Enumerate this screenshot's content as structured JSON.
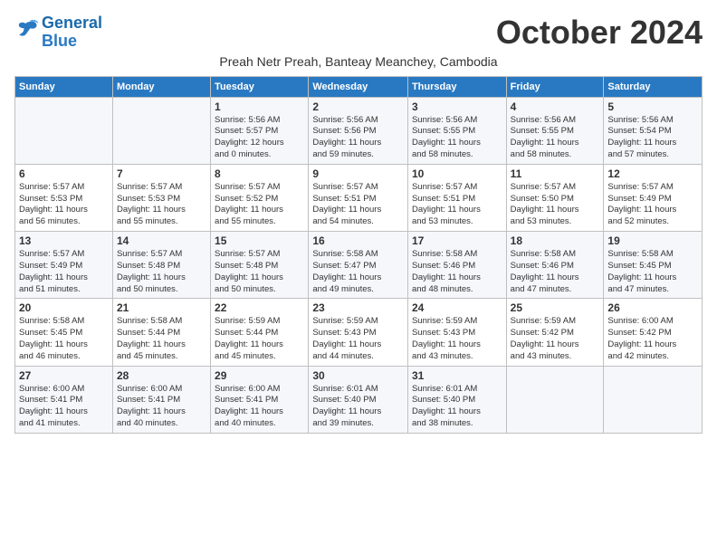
{
  "logo": {
    "line1": "General",
    "line2": "Blue"
  },
  "title": "October 2024",
  "subtitle": "Preah Netr Preah, Banteay Meanchey, Cambodia",
  "days_of_week": [
    "Sunday",
    "Monday",
    "Tuesday",
    "Wednesday",
    "Thursday",
    "Friday",
    "Saturday"
  ],
  "weeks": [
    [
      {
        "day": "",
        "info": ""
      },
      {
        "day": "",
        "info": ""
      },
      {
        "day": "1",
        "info": "Sunrise: 5:56 AM\nSunset: 5:57 PM\nDaylight: 12 hours\nand 0 minutes."
      },
      {
        "day": "2",
        "info": "Sunrise: 5:56 AM\nSunset: 5:56 PM\nDaylight: 11 hours\nand 59 minutes."
      },
      {
        "day": "3",
        "info": "Sunrise: 5:56 AM\nSunset: 5:55 PM\nDaylight: 11 hours\nand 58 minutes."
      },
      {
        "day": "4",
        "info": "Sunrise: 5:56 AM\nSunset: 5:55 PM\nDaylight: 11 hours\nand 58 minutes."
      },
      {
        "day": "5",
        "info": "Sunrise: 5:56 AM\nSunset: 5:54 PM\nDaylight: 11 hours\nand 57 minutes."
      }
    ],
    [
      {
        "day": "6",
        "info": "Sunrise: 5:57 AM\nSunset: 5:53 PM\nDaylight: 11 hours\nand 56 minutes."
      },
      {
        "day": "7",
        "info": "Sunrise: 5:57 AM\nSunset: 5:53 PM\nDaylight: 11 hours\nand 55 minutes."
      },
      {
        "day": "8",
        "info": "Sunrise: 5:57 AM\nSunset: 5:52 PM\nDaylight: 11 hours\nand 55 minutes."
      },
      {
        "day": "9",
        "info": "Sunrise: 5:57 AM\nSunset: 5:51 PM\nDaylight: 11 hours\nand 54 minutes."
      },
      {
        "day": "10",
        "info": "Sunrise: 5:57 AM\nSunset: 5:51 PM\nDaylight: 11 hours\nand 53 minutes."
      },
      {
        "day": "11",
        "info": "Sunrise: 5:57 AM\nSunset: 5:50 PM\nDaylight: 11 hours\nand 53 minutes."
      },
      {
        "day": "12",
        "info": "Sunrise: 5:57 AM\nSunset: 5:49 PM\nDaylight: 11 hours\nand 52 minutes."
      }
    ],
    [
      {
        "day": "13",
        "info": "Sunrise: 5:57 AM\nSunset: 5:49 PM\nDaylight: 11 hours\nand 51 minutes."
      },
      {
        "day": "14",
        "info": "Sunrise: 5:57 AM\nSunset: 5:48 PM\nDaylight: 11 hours\nand 50 minutes."
      },
      {
        "day": "15",
        "info": "Sunrise: 5:57 AM\nSunset: 5:48 PM\nDaylight: 11 hours\nand 50 minutes."
      },
      {
        "day": "16",
        "info": "Sunrise: 5:58 AM\nSunset: 5:47 PM\nDaylight: 11 hours\nand 49 minutes."
      },
      {
        "day": "17",
        "info": "Sunrise: 5:58 AM\nSunset: 5:46 PM\nDaylight: 11 hours\nand 48 minutes."
      },
      {
        "day": "18",
        "info": "Sunrise: 5:58 AM\nSunset: 5:46 PM\nDaylight: 11 hours\nand 47 minutes."
      },
      {
        "day": "19",
        "info": "Sunrise: 5:58 AM\nSunset: 5:45 PM\nDaylight: 11 hours\nand 47 minutes."
      }
    ],
    [
      {
        "day": "20",
        "info": "Sunrise: 5:58 AM\nSunset: 5:45 PM\nDaylight: 11 hours\nand 46 minutes."
      },
      {
        "day": "21",
        "info": "Sunrise: 5:58 AM\nSunset: 5:44 PM\nDaylight: 11 hours\nand 45 minutes."
      },
      {
        "day": "22",
        "info": "Sunrise: 5:59 AM\nSunset: 5:44 PM\nDaylight: 11 hours\nand 45 minutes."
      },
      {
        "day": "23",
        "info": "Sunrise: 5:59 AM\nSunset: 5:43 PM\nDaylight: 11 hours\nand 44 minutes."
      },
      {
        "day": "24",
        "info": "Sunrise: 5:59 AM\nSunset: 5:43 PM\nDaylight: 11 hours\nand 43 minutes."
      },
      {
        "day": "25",
        "info": "Sunrise: 5:59 AM\nSunset: 5:42 PM\nDaylight: 11 hours\nand 43 minutes."
      },
      {
        "day": "26",
        "info": "Sunrise: 6:00 AM\nSunset: 5:42 PM\nDaylight: 11 hours\nand 42 minutes."
      }
    ],
    [
      {
        "day": "27",
        "info": "Sunrise: 6:00 AM\nSunset: 5:41 PM\nDaylight: 11 hours\nand 41 minutes."
      },
      {
        "day": "28",
        "info": "Sunrise: 6:00 AM\nSunset: 5:41 PM\nDaylight: 11 hours\nand 40 minutes."
      },
      {
        "day": "29",
        "info": "Sunrise: 6:00 AM\nSunset: 5:41 PM\nDaylight: 11 hours\nand 40 minutes."
      },
      {
        "day": "30",
        "info": "Sunrise: 6:01 AM\nSunset: 5:40 PM\nDaylight: 11 hours\nand 39 minutes."
      },
      {
        "day": "31",
        "info": "Sunrise: 6:01 AM\nSunset: 5:40 PM\nDaylight: 11 hours\nand 38 minutes."
      },
      {
        "day": "",
        "info": ""
      },
      {
        "day": "",
        "info": ""
      }
    ]
  ]
}
